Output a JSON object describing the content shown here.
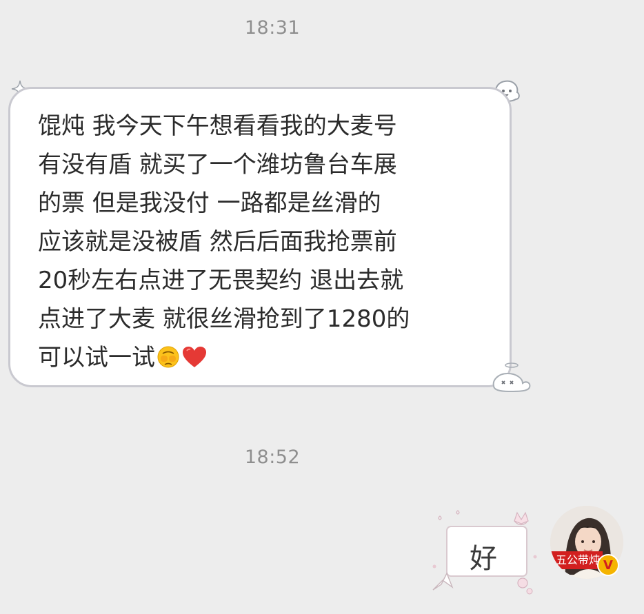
{
  "chat": {
    "timestamp_1": "18:31",
    "timestamp_2": "18:52",
    "incoming_message": "馄炖 我今天下午想看看我的大麦号\n有没有盾 就买了一个潍坊鲁台车展\n的票 但是我没付 一路都是丝滑的\n应该就是没被盾 然后后面我抢票前\n20秒左右点进了无畏契约 退出去就\n点进了大麦 就很丝滑抢到了1280的\n可以试一试",
    "incoming_emojis": [
      "see-no-evil-emoji",
      "heart-emoji"
    ],
    "outgoing_message": "好"
  },
  "avatar": {
    "badge_text": "五公带炖",
    "verified_mark": "V"
  },
  "colors": {
    "background": "#ededed",
    "bubble_border": "#c9c9d0",
    "heart": "#e53935",
    "badge": "#d21f1f",
    "verified": "#f5b400"
  }
}
